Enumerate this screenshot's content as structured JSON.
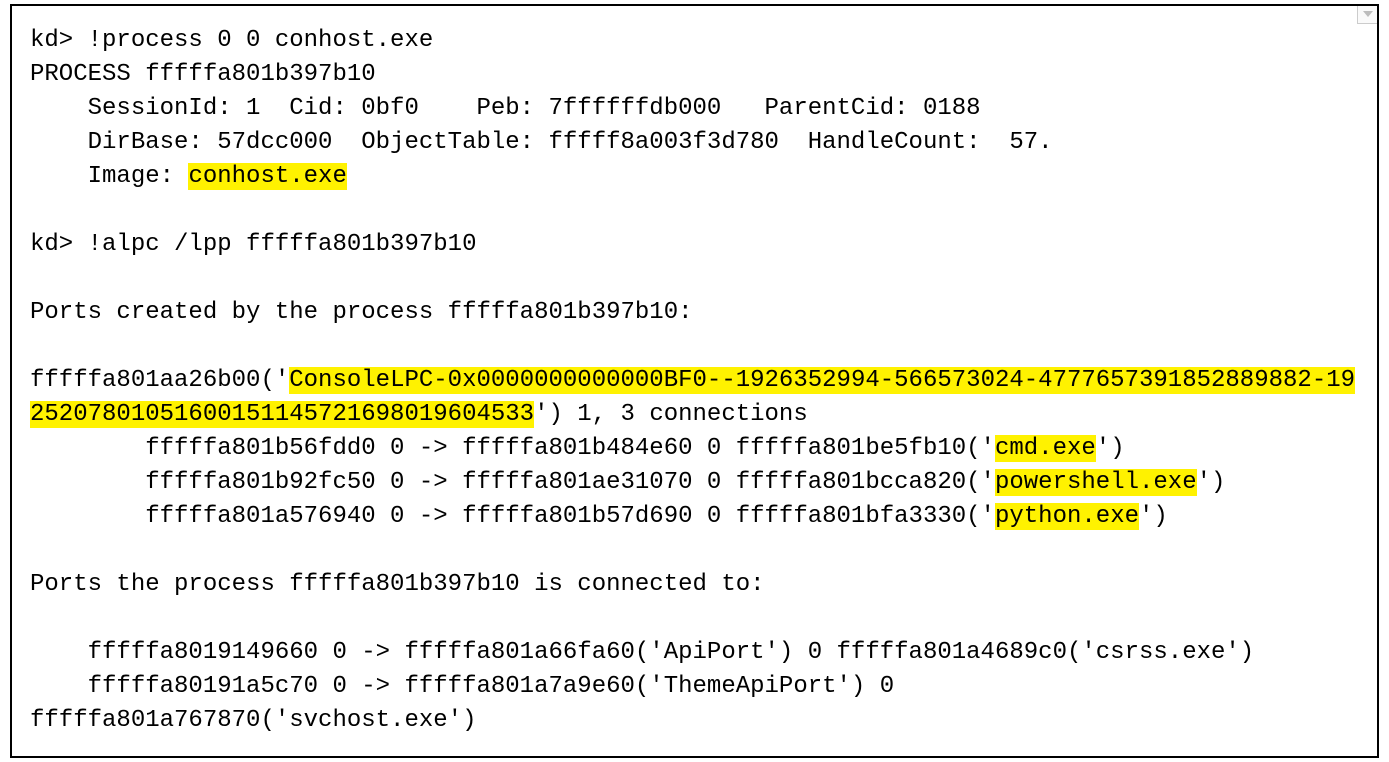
{
  "cmd1_prompt": "kd> ",
  "cmd1_text": "!process 0 0 conhost.exe",
  "proc_line": "PROCESS fffffa801b397b10",
  "proc_sess_line": "    SessionId: 1  Cid: 0bf0    Peb: 7ffffffdb000   ParentCid: 0188",
  "proc_dir_line": "    DirBase: 57dcc000  ObjectTable: fffff8a003f3d780  HandleCount:  57.",
  "proc_image_prefix": "    Image: ",
  "proc_image_hl": "conhost.exe",
  "cmd2_prompt": "kd> ",
  "cmd2_text": "!alpc /lpp fffffa801b397b10",
  "ports_created_line": "Ports created by the process fffffa801b397b10:",
  "portentry_prefix": "fffffa801aa26b00('",
  "portentry_hl_part1": "ConsoleLPC-0x0000000000000BF0--1926352994-566573024-4777657391852889882-19",
  "portentry_hl_part2": "25207801051600151145721698019604533",
  "portentry_suffix": "') 1, 3 connections",
  "conn1_prefix": "        fffffa801b56fdd0 0 -> fffffa801b484e60 0 fffffa801be5fb10('",
  "conn1_hl": "cmd.exe",
  "conn1_suffix": "')",
  "conn2_prefix": "        fffffa801b92fc50 0 -> fffffa801ae31070 0 fffffa801bcca820('",
  "conn2_hl": "powershell.exe",
  "conn2_suffix": "')",
  "conn3_prefix": "        fffffa801a576940 0 -> fffffa801b57d690 0 fffffa801bfa3330('",
  "conn3_hl": "python.exe",
  "conn3_suffix": "')",
  "ports_connected_line": "Ports the process fffffa801b397b10 is connected to:",
  "out1_line": "    fffffa8019149660 0 -> fffffa801a66fa60('ApiPort') 0 fffffa801a4689c0('csrss.exe')",
  "out2_line": "    fffffa80191a5c70 0 -> fffffa801a7a9e60('ThemeApiPort') 0 ",
  "out3_line": "fffffa801a767870('svchost.exe')"
}
